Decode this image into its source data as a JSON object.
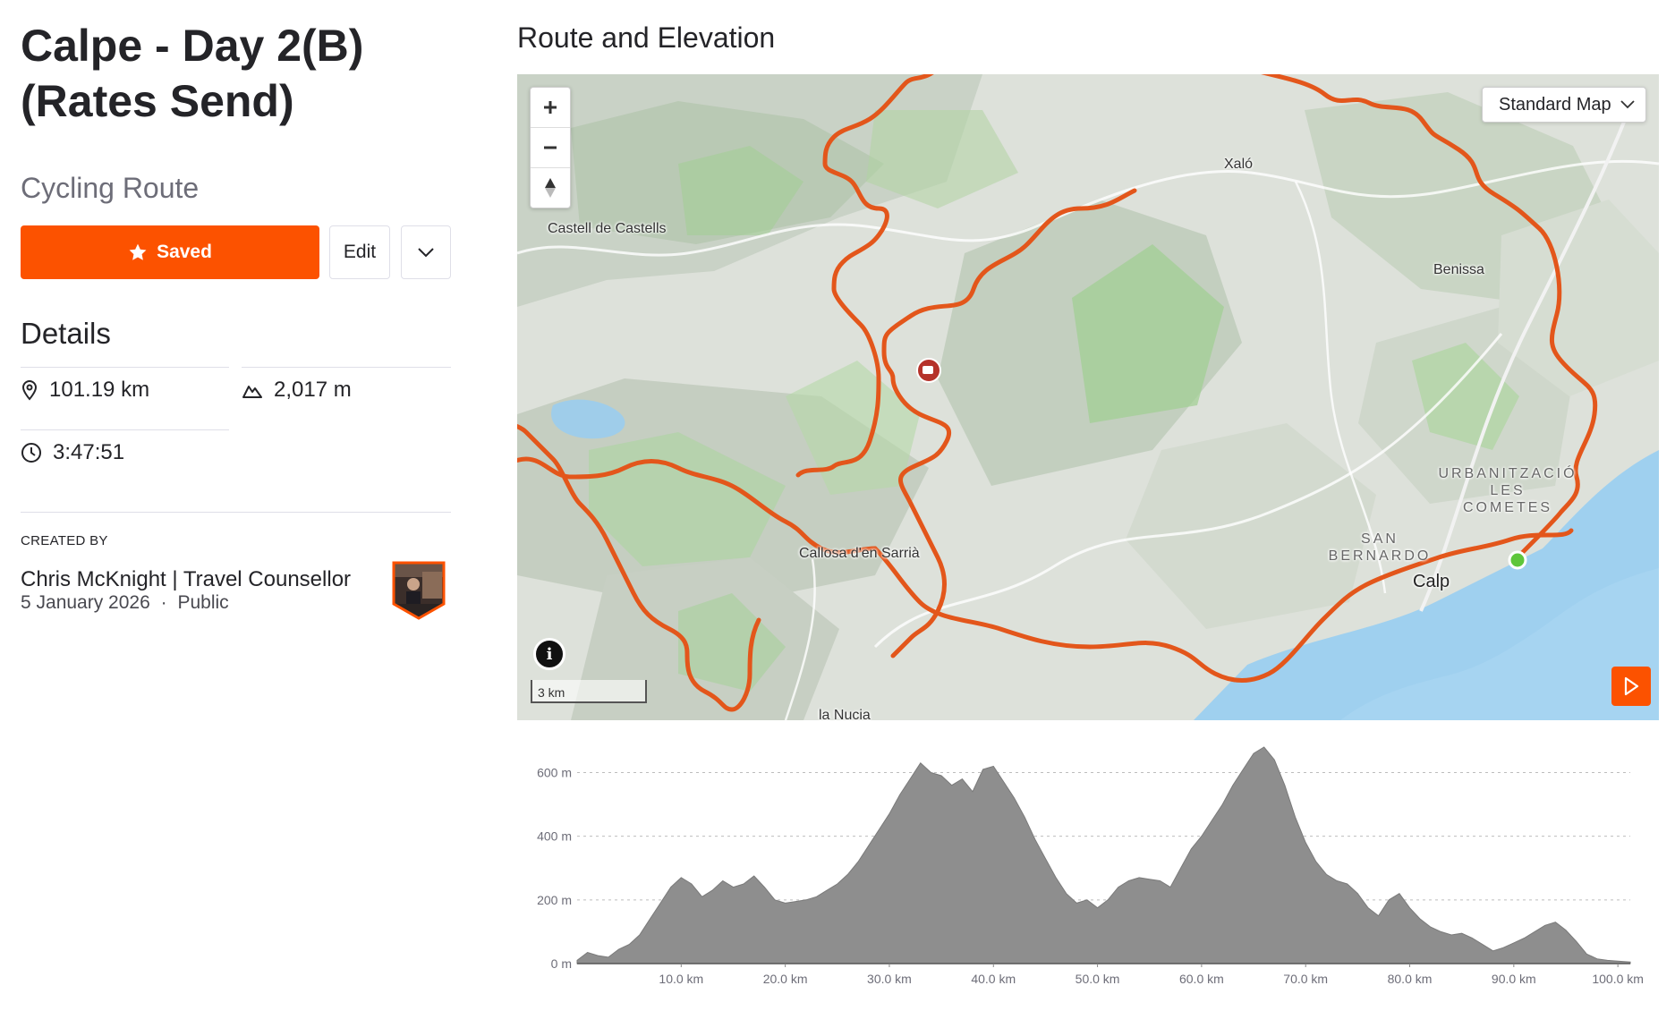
{
  "route": {
    "title": "Calpe - Day 2(B) (Rates Send)",
    "type": "Cycling Route",
    "saved_label": "Saved",
    "edit_label": "Edit"
  },
  "details": {
    "heading": "Details",
    "distance": "101.19 km",
    "elevation_gain": "2,017 m",
    "time": "3:47:51"
  },
  "creator": {
    "label": "CREATED BY",
    "name": "Chris McKnight | Travel Counsellor",
    "date": "5 January 2026",
    "separator": "·",
    "visibility": "Public"
  },
  "map": {
    "section_title": "Route and Elevation",
    "map_type": "Standard Map",
    "scale_label": "3 km",
    "route_color": "#e3561b",
    "start_color": "#5ec63b",
    "labels": {
      "castell": "Castell de Castells",
      "xalo": "Xaló",
      "benissa": "Benissa",
      "callosa": "Callosa d'en Sarrià",
      "calp": "Calp",
      "nucia": "la Nucia",
      "cometes": [
        "URBANITZACIÓ",
        "LES",
        "COMETES"
      ],
      "bernardo": [
        "SAN",
        "BERNARDO"
      ]
    }
  },
  "chart_data": {
    "type": "area",
    "xlabel": "",
    "ylabel": "",
    "xlim": [
      0,
      101.19
    ],
    "ylim": [
      0,
      680
    ],
    "y_ticks": [
      "0 m",
      "200 m",
      "400 m",
      "600 m"
    ],
    "x_ticks": [
      "10.0 km",
      "20.0 km",
      "30.0 km",
      "40.0 km",
      "50.0 km",
      "60.0 km",
      "70.0 km",
      "80.0 km",
      "90.0 km",
      "100.0 km"
    ],
    "x": [
      0,
      1,
      2,
      3,
      4,
      5,
      6,
      7,
      8,
      9,
      10,
      11,
      12,
      13,
      14,
      15,
      16,
      17,
      18,
      19,
      20,
      21,
      22,
      23,
      24,
      25,
      26,
      27,
      28,
      29,
      30,
      31,
      32,
      33,
      34,
      35,
      36,
      37,
      38,
      39,
      40,
      41,
      42,
      43,
      44,
      45,
      46,
      47,
      48,
      49,
      50,
      51,
      52,
      53,
      54,
      55,
      56,
      57,
      58,
      59,
      60,
      61,
      62,
      63,
      64,
      65,
      66,
      67,
      68,
      69,
      70,
      71,
      72,
      73,
      74,
      75,
      76,
      77,
      78,
      79,
      80,
      81,
      82,
      83,
      84,
      85,
      86,
      87,
      88,
      89,
      90,
      91,
      92,
      93,
      94,
      95,
      96,
      97,
      98,
      99,
      100,
      101.19
    ],
    "values": [
      10,
      35,
      25,
      20,
      45,
      60,
      90,
      140,
      190,
      240,
      270,
      250,
      210,
      230,
      260,
      240,
      250,
      275,
      240,
      200,
      190,
      195,
      200,
      210,
      230,
      250,
      280,
      320,
      370,
      420,
      470,
      530,
      580,
      630,
      600,
      590,
      560,
      580,
      540,
      610,
      620,
      570,
      520,
      460,
      390,
      330,
      270,
      220,
      190,
      200,
      175,
      200,
      240,
      260,
      270,
      265,
      260,
      240,
      300,
      360,
      400,
      450,
      500,
      560,
      610,
      660,
      680,
      640,
      560,
      460,
      380,
      320,
      280,
      260,
      250,
      220,
      175,
      150,
      200,
      220,
      175,
      140,
      115,
      100,
      90,
      95,
      80,
      60,
      40,
      50,
      65,
      80,
      100,
      120,
      130,
      105,
      70,
      30,
      15,
      10,
      8,
      5
    ]
  }
}
